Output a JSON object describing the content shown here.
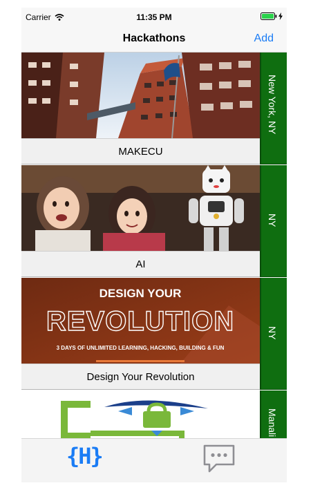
{
  "status_bar": {
    "carrier": "Carrier",
    "time": "11:35 PM"
  },
  "nav": {
    "title": "Hackathons",
    "add_label": "Add"
  },
  "hackathons": [
    {
      "name": "MAKECU",
      "location": "New York, NY",
      "image": "campus-buildings-with-flag"
    },
    {
      "name": "AI",
      "location": "NY",
      "image": "children-with-robot"
    },
    {
      "name": "Design Your Revolution",
      "location": "NY",
      "image": "design-your-revolution-banner",
      "banner": {
        "line1": "DESIGN YOUR",
        "line2": "REVOLUTION",
        "line3": "3 DAYS OF UNLIMITED LEARNING, HACKING, BUILDING & FUN"
      }
    },
    {
      "name": "",
      "location": "Manali",
      "image": "lock-logo"
    }
  ],
  "tabs": [
    {
      "label": "{H}",
      "icon": "hackathons-tab-icon",
      "active": true
    },
    {
      "label": "",
      "icon": "chat-bubble-icon",
      "active": false
    }
  ],
  "colors": {
    "accent": "#1a7cf5",
    "location_bar": "#0f6e10"
  }
}
